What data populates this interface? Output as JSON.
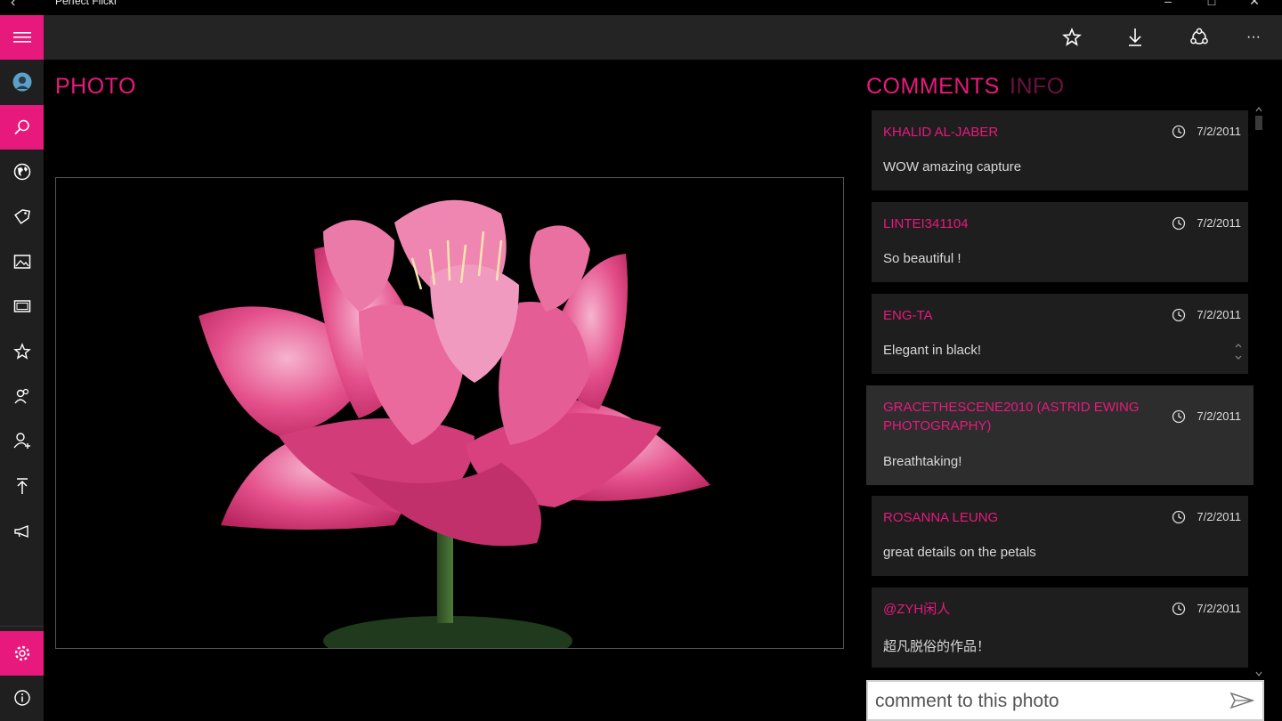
{
  "window": {
    "title": "Perfect Flickr"
  },
  "sidebar": {
    "items": [
      {
        "icon": "avatar"
      },
      {
        "icon": "search-icon"
      },
      {
        "icon": "globe-icon"
      },
      {
        "icon": "tag-icon"
      },
      {
        "icon": "image-icon"
      },
      {
        "icon": "album-icon"
      },
      {
        "icon": "star-icon"
      },
      {
        "icon": "people-icon"
      },
      {
        "icon": "add-contact-icon"
      },
      {
        "icon": "upload-icon"
      },
      {
        "icon": "megaphone-icon"
      }
    ],
    "bottom": [
      {
        "icon": "settings-icon"
      },
      {
        "icon": "info-icon"
      }
    ]
  },
  "toolbar": {
    "icons": [
      "star-icon",
      "download-icon",
      "share-icon",
      "more-icon"
    ],
    "more_label": "···"
  },
  "photo": {
    "header": "PHOTO"
  },
  "panel": {
    "tabs": [
      {
        "label": "COMMENTS"
      },
      {
        "label": "INFO"
      }
    ],
    "comments": [
      {
        "author": "KHALID AL-JABER",
        "date": "7/2/2011",
        "text": "WOW amazing capture"
      },
      {
        "author": "LINTEI341104",
        "date": "7/2/2011",
        "text": "So beautiful !"
      },
      {
        "author": "ENG-TA",
        "date": "7/2/2011",
        "text": "Elegant in black!"
      },
      {
        "author": "GRACETHESCENE2010 (ASTRID EWING PHOTOGRAPHY)",
        "date": "7/2/2011",
        "text": "Breathtaking!"
      },
      {
        "author": "ROSANNA LEUNG",
        "date": "7/2/2011",
        "text": "great details on the petals"
      },
      {
        "author": "@ZYH闲人",
        "date": "7/2/2011",
        "text": "超凡脱俗的作品！"
      }
    ],
    "input_placeholder": "comment to this photo"
  },
  "colors": {
    "accent": "#e8197d",
    "accent_dim": "#6b1240",
    "background": "#000000",
    "sidebar": "#1f1f1f",
    "card": "#1e1e1e"
  }
}
